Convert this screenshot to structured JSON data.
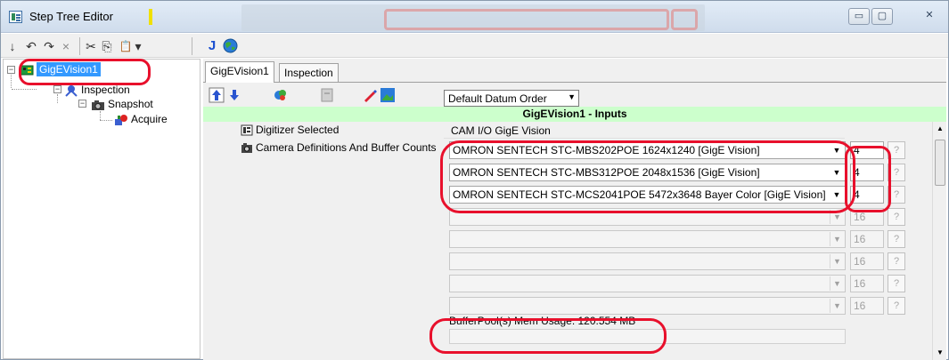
{
  "window": {
    "title": "Step Tree Editor",
    "controls": {
      "minimize": "▭",
      "maximize": "▢",
      "close": "✕"
    }
  },
  "toolbar": {
    "icons": [
      "insert-arrow-icon",
      "undo-icon",
      "redo-icon",
      "delete-icon",
      "cut-icon",
      "copy-icon",
      "paste-icon",
      "dropdown-icon",
      "java-icon",
      "globe-icon"
    ],
    "glyphs": {
      "insert": "↓",
      "undo": "↶",
      "redo": "↷",
      "delete": "×",
      "cut": "✂",
      "copy": "⎘",
      "paste": "📋",
      "dropdown": "▾",
      "java": "J"
    }
  },
  "tree": {
    "root": {
      "label": "GigEVision1"
    },
    "children": [
      {
        "label": "Inspection"
      },
      {
        "label": "Snapshot"
      },
      {
        "label": "Acquire"
      }
    ]
  },
  "tabs": [
    {
      "label": "GigEVision1",
      "active": true
    },
    {
      "label": "Inspection",
      "active": false
    }
  ],
  "datum_order": {
    "selected": "Default Datum Order"
  },
  "inputs_header": "GigEVision1 - Inputs",
  "rows": {
    "digitizer": {
      "label": "Digitizer Selected",
      "value": "CAM I/O GigE Vision"
    },
    "camera_defs": {
      "label": "Camera Definitions And Buffer Counts"
    }
  },
  "cameras": [
    {
      "name": "OMRON SENTECH STC-MBS202POE 1624x1240 [GigE Vision]",
      "count": "4",
      "help": "?"
    },
    {
      "name": "OMRON SENTECH STC-MBS312POE 2048x1536 [GigE Vision]",
      "count": "4",
      "help": "?"
    },
    {
      "name": "OMRON SENTECH STC-MCS2041POE 5472x3648 Bayer Color [GigE Vision]",
      "count": "4",
      "help": "?"
    },
    {
      "name": "",
      "count": "16",
      "help": "?"
    },
    {
      "name": "",
      "count": "16",
      "help": "?"
    },
    {
      "name": "",
      "count": "16",
      "help": "?"
    },
    {
      "name": "",
      "count": "16",
      "help": "?"
    },
    {
      "name": "",
      "count": "16",
      "help": "?"
    }
  ],
  "buffer_pool": {
    "text": "BufferPool(s) Mem Usage: 120.554 MB"
  },
  "annotation_color": "#e8102c"
}
